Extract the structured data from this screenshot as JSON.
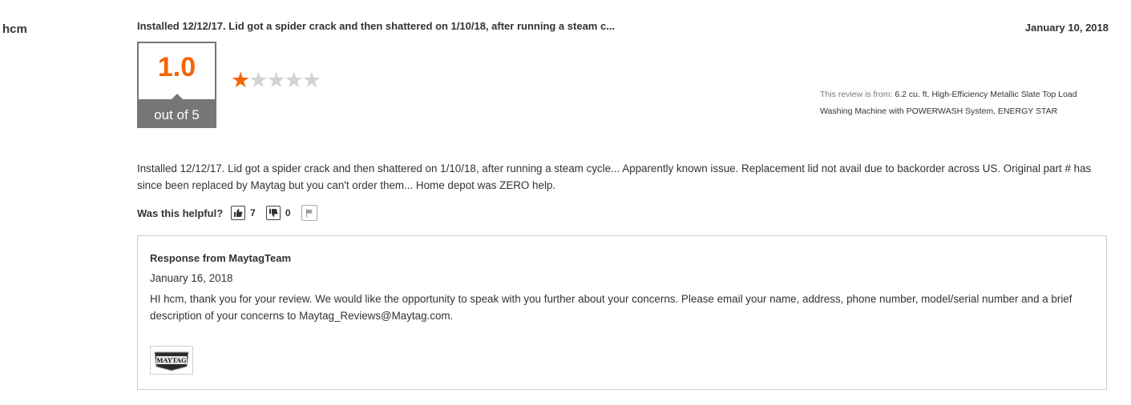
{
  "review": {
    "author": "hcm",
    "title": "Installed 12/12/17. Lid got a spider crack and then shattered on 1/10/18, after running a steam c...",
    "date": "January 10, 2018",
    "rating": {
      "value": "1.0",
      "out_of_label": "out of 5",
      "stars_filled": 1,
      "stars_total": 5,
      "accent_color": "#f96302"
    },
    "product": {
      "from_label": "This review is from:",
      "name": "6.2 cu. ft. High-Efficiency Metallic Slate Top Load Washing Machine with POWERWASH System, ENERGY STAR"
    },
    "body": "Installed 12/12/17. Lid got a spider crack and then shattered on 1/10/18, after running a steam cycle... Apparently known issue. Replacement lid not avail due to backorder across US. Original part # has since been replaced by Maytag but you can't order them... Home depot was ZERO help.",
    "helpful": {
      "label": "Was this helpful?",
      "up_count": "7",
      "down_count": "0",
      "up_icon": "thumbs-up-icon",
      "down_icon": "thumbs-down-icon",
      "report_icon": "flag-icon"
    }
  },
  "response": {
    "heading": "Response from MaytagTeam",
    "date": "January 16, 2018",
    "body": "HI hcm, thank you for your review. We would like the opportunity to speak with you further about your concerns. Please email your name, address, phone number, model/serial number and a brief description of your concerns to Maytag_Reviews@Maytag.com.",
    "logo_text": "MAYTAG"
  }
}
